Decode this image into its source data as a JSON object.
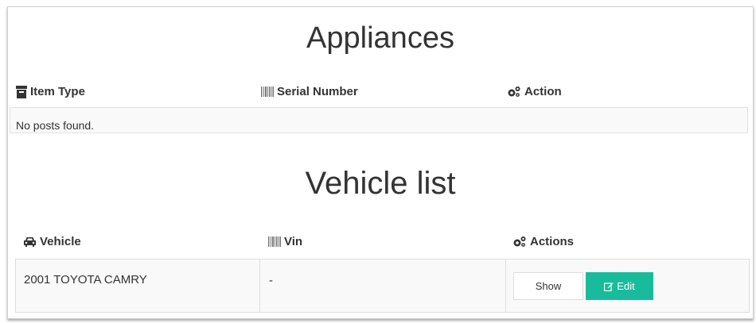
{
  "appliances": {
    "title": "Appliances",
    "columns": [
      {
        "label": "Item Type",
        "icon": "archive-icon"
      },
      {
        "label": "Serial Number",
        "icon": "barcode-icon"
      },
      {
        "label": "Action",
        "icon": "cogs-icon"
      }
    ],
    "empty_message": "No posts found."
  },
  "vehicles": {
    "title": "Vehicle list",
    "columns": [
      {
        "label": "Vehicle",
        "icon": "car-icon"
      },
      {
        "label": "Vin",
        "icon": "barcode-icon"
      },
      {
        "label": "Actions",
        "icon": "cogs-icon"
      }
    ],
    "rows": [
      {
        "vehicle": "2001 TOYOTA CAMRY",
        "vin": "-",
        "show_label": "Show",
        "edit_label": "Edit"
      }
    ]
  },
  "colors": {
    "accent": "#18bc9c",
    "text": "#333333",
    "border": "#dddddd",
    "stripe": "#f9f9f9"
  }
}
